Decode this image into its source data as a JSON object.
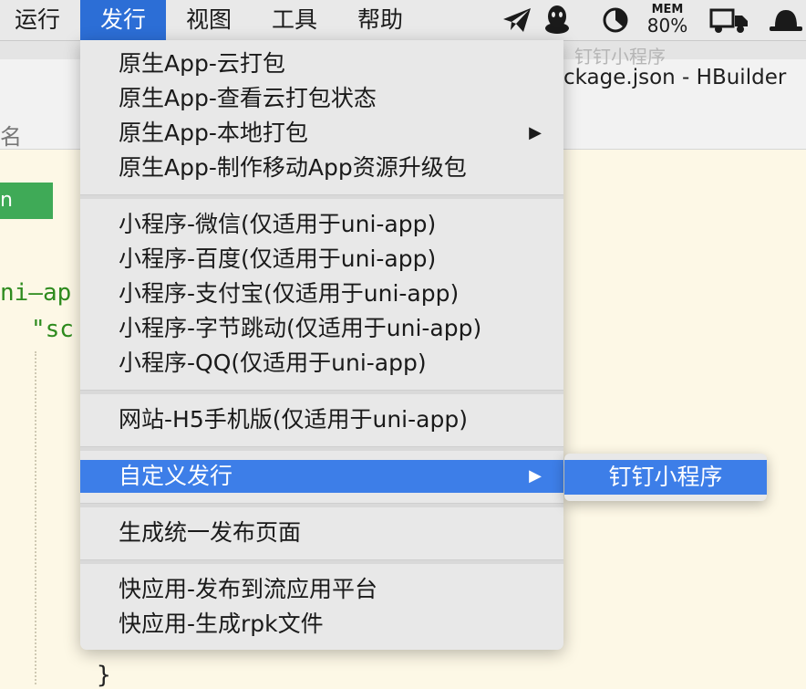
{
  "menubar": {
    "items": [
      "运行",
      "发行",
      "视图",
      "工具",
      "帮助"
    ],
    "active_index": 1,
    "status_icons": [
      "paper-plane-icon",
      "qq-penguin-icon",
      "clock-icon",
      "mem-monitor",
      "truck-icon",
      "hat-icon"
    ],
    "mem_label": "MEM",
    "mem_value": "80%"
  },
  "background": {
    "ghost_tab": "钉钉小程序",
    "window_title": "ckage.json - HBuilder",
    "name_fragment": "名",
    "green_button_fragment": "n",
    "code_lines": [
      "ni–ap",
      "\"sc"
    ],
    "brace": "}"
  },
  "menu": {
    "groups": [
      [
        {
          "label": "原生App-云打包"
        },
        {
          "label": "原生App-查看云打包状态"
        },
        {
          "label": "原生App-本地打包",
          "submenu": true
        },
        {
          "label": "原生App-制作移动App资源升级包"
        }
      ],
      [
        {
          "label": "小程序-微信(仅适用于uni-app)"
        },
        {
          "label": "小程序-百度(仅适用于uni-app)"
        },
        {
          "label": "小程序-支付宝(仅适用于uni-app)"
        },
        {
          "label": "小程序-字节跳动(仅适用于uni-app)"
        },
        {
          "label": "小程序-QQ(仅适用于uni-app)"
        }
      ],
      [
        {
          "label": "网站-H5手机版(仅适用于uni-app)"
        }
      ],
      [
        {
          "label": "自定义发行",
          "submenu": true,
          "highlighted": true
        }
      ],
      [
        {
          "label": "生成统一发布页面"
        }
      ],
      [
        {
          "label": "快应用-发布到流应用平台"
        },
        {
          "label": "快应用-生成rpk文件"
        }
      ]
    ],
    "submenu_arrow": "▶"
  },
  "submenu": {
    "items": [
      "钉钉小程序"
    ]
  },
  "colors": {
    "highlight": "#3d7ee8",
    "menubar_active": "#2c6ed6",
    "editor_bg": "#fdf8e6",
    "green_button": "#3faa57"
  }
}
